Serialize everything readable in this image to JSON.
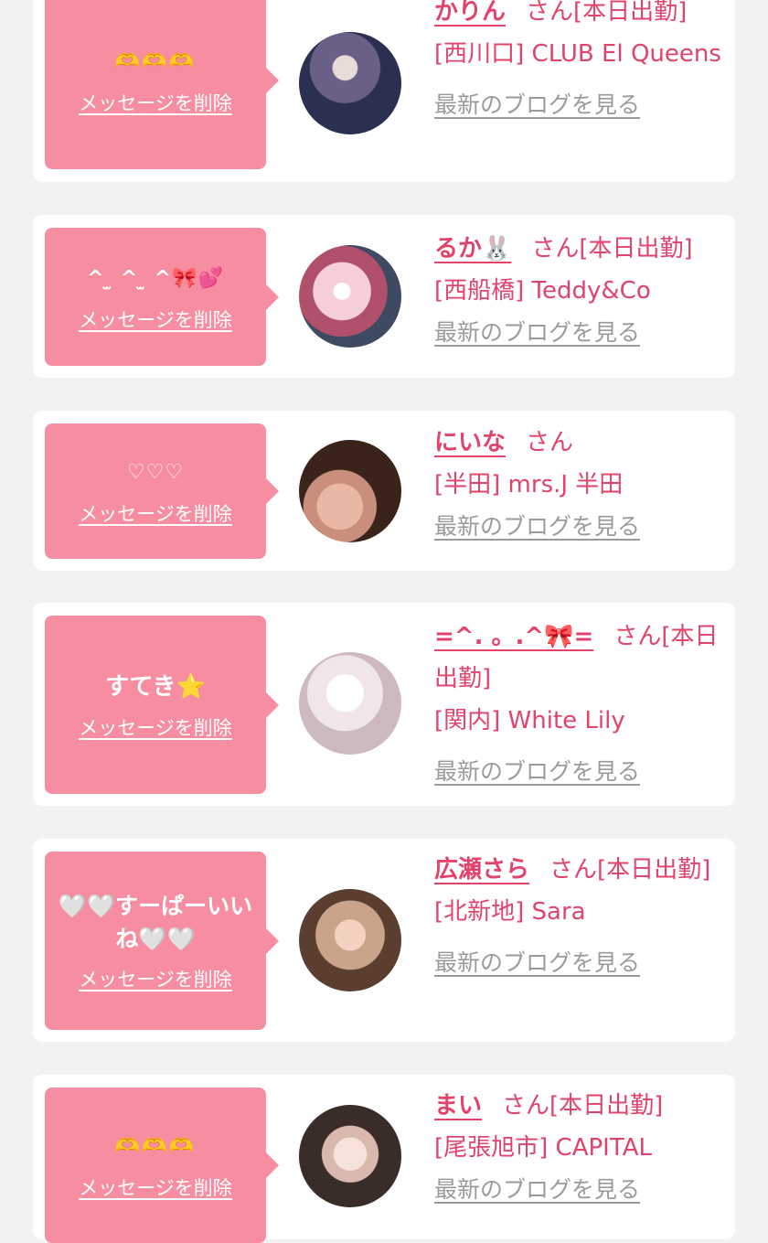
{
  "cards": [
    {
      "message": "🫶🫶🫶",
      "delete_label": "メッセージを削除",
      "name": "かりん",
      "suffix": "さん[本日出勤]",
      "shop": "[西川口] CLUB El Queens",
      "blog_label": "最新のブログを見る",
      "avatar_colors": [
        "#2b2f52",
        "#6a5f86"
      ]
    },
    {
      "message": "^ ̫ ^ ̫ ^🎀💕",
      "delete_label": "メッセージを削除",
      "name": "るか🐰",
      "suffix": "さん[本日出勤]",
      "shop": "[西船橋] Teddy&Co",
      "blog_label": "最新のブログを見る",
      "avatar_colors": [
        "#f6cfd8",
        "#8a3a4a"
      ]
    },
    {
      "message": "♡♡♡",
      "delete_label": "メッセージを削除",
      "name": "にいな",
      "suffix": "さん",
      "shop": "[半田] mrs.J 半田",
      "blog_label": "最新のブログを見る",
      "avatar_colors": [
        "#3a2319",
        "#d9a48c"
      ]
    },
    {
      "message": "すてき⭐️",
      "delete_label": "メッセージを削除",
      "name": "=^. 。.^🎀=",
      "suffix": "さん[本日出勤]",
      "shop": "[関内] White Lily",
      "blog_label": "最新のブログを見る",
      "avatar_colors": [
        "#f0e6ea",
        "#d2c0c8"
      ]
    },
    {
      "message": "🤍🤍すーぱーいいね🤍🤍",
      "delete_label": "メッセージを削除",
      "name": "広瀬さら",
      "suffix": "さん[本日出勤]",
      "shop": "[北新地] Sara",
      "blog_label": "最新のブログを見る",
      "avatar_colors": [
        "#c9a38a",
        "#5b3e2f"
      ]
    },
    {
      "message": "🫶🫶🫶",
      "delete_label": "メッセージを削除",
      "name": "まい",
      "suffix": "さん[本日出勤]",
      "shop": "[尾張旭市] CAPITAL",
      "blog_label": "最新のブログを見る",
      "avatar_colors": [
        "#ead8d0",
        "#3a2c28"
      ]
    }
  ]
}
